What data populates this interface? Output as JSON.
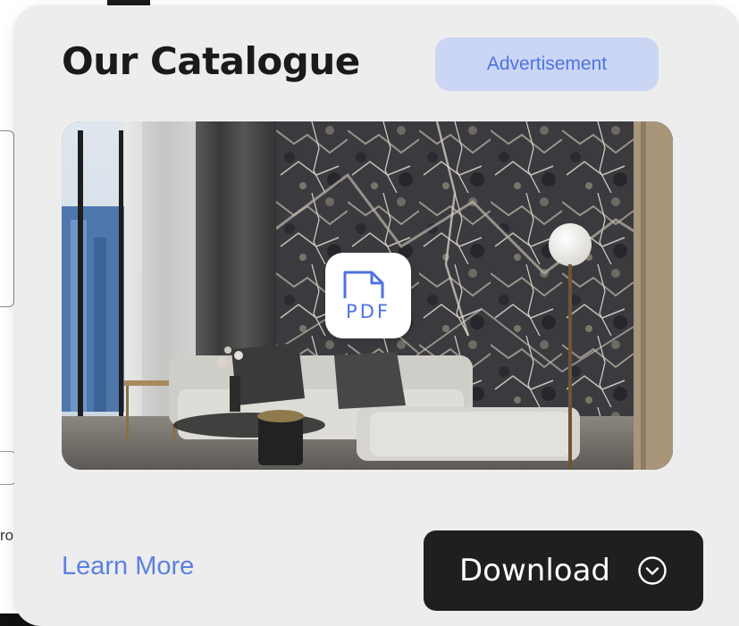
{
  "card": {
    "title": "Our Catalogue",
    "badge": "Advertisement",
    "file_type_label": "PDF",
    "learn_more_label": "Learn More",
    "download_label": "Download",
    "icons": {
      "file": "pdf-file-icon",
      "download_chevron": "chevron-down-circle-icon"
    }
  },
  "background": {
    "fragment_text": "ro"
  },
  "colors": {
    "card_bg": "#ededed",
    "accent": "#5b80e4",
    "badge_bg": "#cbd6f5",
    "button_bg": "#1f1f1f",
    "button_text": "#ffffff",
    "title": "#1a1a1a"
  }
}
